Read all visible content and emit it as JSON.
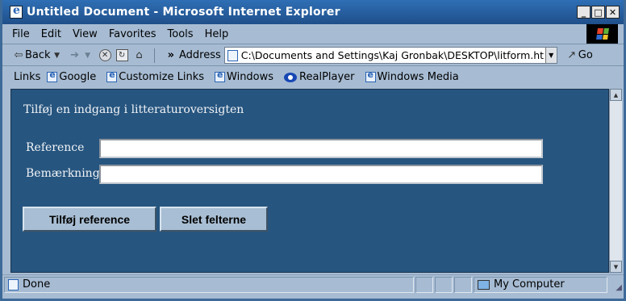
{
  "window": {
    "title": "Untitled Document - Microsoft Internet Explorer",
    "controls": [
      "_",
      "□",
      "✕"
    ]
  },
  "menu": [
    "File",
    "Edit",
    "View",
    "Favorites",
    "Tools",
    "Help"
  ],
  "toolbar": {
    "back_label": "Back",
    "address_label": "Address",
    "address_value": "C:\\Documents and Settings\\Kaj Gronbak\\DESKTOP\\litform.ht",
    "go_label": "Go",
    "chevron": "»"
  },
  "links": {
    "label": "Links",
    "items": [
      "Google",
      "Customize Links",
      "Windows",
      "RealPlayer",
      "Windows Media"
    ]
  },
  "form": {
    "heading": "Tilføj en indgang i litteraturoversigten",
    "reference_label": "Reference",
    "remark_label": "Bemærkning",
    "reference_value": "",
    "remark_value": "",
    "add_button": "Tilføj reference",
    "clear_button": "Slet felterne"
  },
  "status": {
    "text": "Done",
    "zone": "My Computer"
  },
  "colors": {
    "content_bg": "#26557f",
    "chrome": "#a7bcd3",
    "titlebar": "#2f6fb5"
  }
}
